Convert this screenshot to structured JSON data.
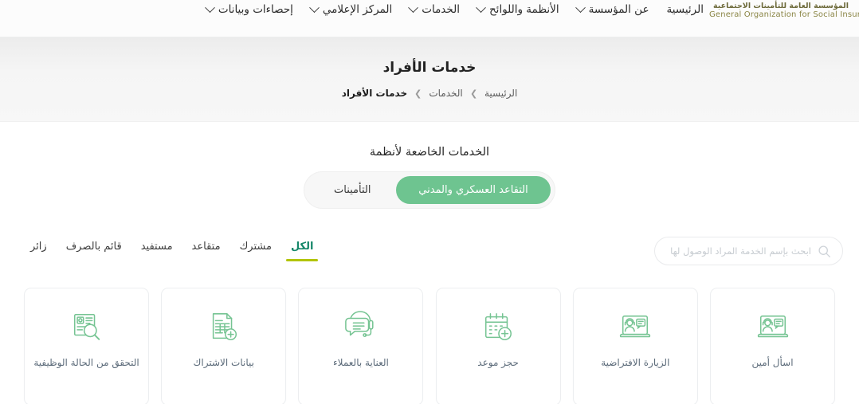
{
  "brand": {
    "logo_arabic": "المؤسسة العامة للتأمينات الاجتماعية",
    "logo_english": "General Organization for Social Insurance",
    "shield_color": "#2f6043",
    "swoosh_color": "#b39a5b",
    "logo_text_color": "#6d6a3a"
  },
  "nav": {
    "items": [
      {
        "label": "الرئيسية",
        "has_dropdown": false
      },
      {
        "label": "عن المؤسسة",
        "has_dropdown": true
      },
      {
        "label": "الأنظمة واللوائح",
        "has_dropdown": true
      },
      {
        "label": "الخدمات",
        "has_dropdown": true
      },
      {
        "label": "المركز الإعلامي",
        "has_dropdown": true
      },
      {
        "label": "إحصاءات وبيانات",
        "has_dropdown": true
      }
    ]
  },
  "header": {
    "title": "خدمات الأفراد",
    "breadcrumb": [
      {
        "label": "الرئيسية",
        "current": false
      },
      {
        "label": "الخدمات",
        "current": false
      },
      {
        "label": "خدمات الأفراد",
        "current": true
      }
    ],
    "breadcrumb_separator": "❮"
  },
  "systems_section": {
    "heading": "الخدمات الخاضعة لأنظمة",
    "toggle": [
      {
        "label": "التقاعد العسكري والمدني",
        "active": true
      },
      {
        "label": "التأمينات",
        "active": false
      }
    ],
    "active_color": "#6ec490"
  },
  "filters": {
    "tabs": [
      {
        "label": "الكل",
        "active": true
      },
      {
        "label": "مشترك",
        "active": false
      },
      {
        "label": "متقاعد",
        "active": false
      },
      {
        "label": "مستفيد",
        "active": false
      },
      {
        "label": "قائم بالصرف",
        "active": false
      },
      {
        "label": "زائر",
        "active": false
      }
    ],
    "active_text_color": "#16876a",
    "active_underline_color": "#b2c400"
  },
  "search": {
    "value": "",
    "placeholder": "ابحث بإسم الخدمة المراد الوصول لها",
    "icon": "search-icon"
  },
  "services": {
    "icon_color": "#76c493",
    "cards": [
      {
        "label": "التحقق من الحالة الوظيفية",
        "icon": "document-magnifier-icon"
      },
      {
        "label": "بيانات الاشتراك",
        "icon": "document-plus-icon"
      },
      {
        "label": "العناية بالعملاء",
        "icon": "headset-chat-icon"
      },
      {
        "label": "حجز موعد",
        "icon": "calendar-plus-icon"
      },
      {
        "label": "الزيارة الافتراضية",
        "icon": "video-agent-icon"
      },
      {
        "label": "اسأل أمين",
        "icon": "video-agent-icon"
      }
    ]
  }
}
